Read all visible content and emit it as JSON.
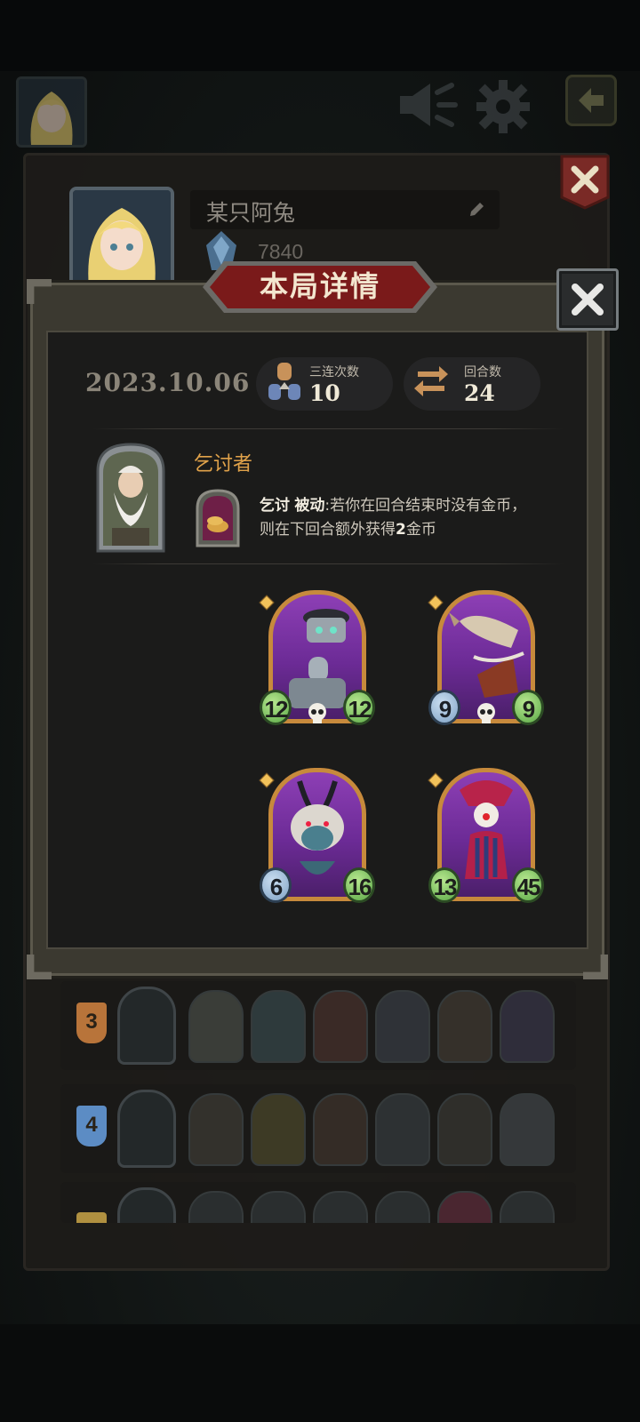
{
  "profile": {
    "name": "某只阿兔",
    "rating": "7840"
  },
  "modal": {
    "title": "本局详情",
    "date": "2023.10.06",
    "stats": [
      {
        "label": "三连次数",
        "value": "10",
        "icon": "triple-icon"
      },
      {
        "label": "回合数",
        "value": "24",
        "icon": "rounds-icon"
      }
    ],
    "hero": {
      "name": "乞讨者",
      "skill_name": "乞讨",
      "skill_type": "被动",
      "skill_desc_1": ":若你在回合结束时没有金币，",
      "skill_desc_2_pre": "则在下回合额外获得",
      "skill_desc_2_bold": "2",
      "skill_desc_2_post": "金币"
    },
    "cards": [
      {
        "name": "robot-unit-card",
        "attack": "12",
        "health": "12",
        "attack_color": "green"
      },
      {
        "name": "rocket-unit-card",
        "attack": "9",
        "health": "9",
        "attack_color": "blue"
      },
      {
        "name": "beast-unit-card",
        "attack": "6",
        "health": "16",
        "attack_color": "blue"
      },
      {
        "name": "clown-unit-card",
        "attack": "13",
        "health": "45",
        "attack_color": "green"
      }
    ]
  },
  "history": [
    {
      "rank": "3",
      "rank_color": "#b8743a"
    },
    {
      "rank": "4",
      "rank_color": "#5c8cc4"
    },
    {
      "rank": "",
      "rank_color": "#b09040"
    }
  ],
  "colors": {
    "accent_gold": "#e0a24a",
    "banner_red": "#7a1a1a",
    "card_border": "#c78a3c",
    "health_green": "#5aa846"
  }
}
